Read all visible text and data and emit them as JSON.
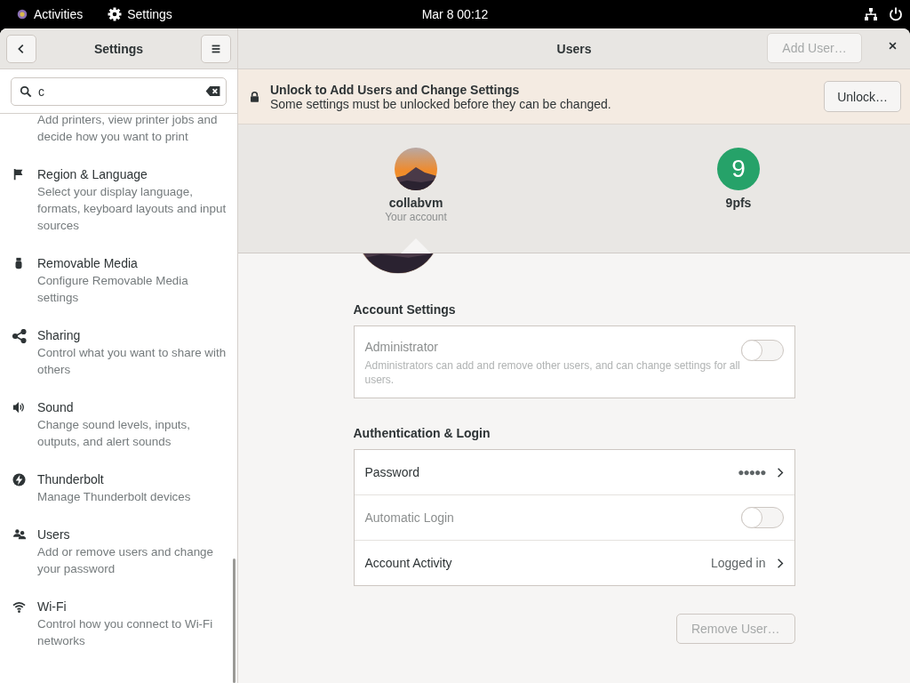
{
  "top_bar": {
    "activities": "Activities",
    "app": "Settings",
    "clock": "Mar 8  00:12"
  },
  "sidebar": {
    "title": "Settings",
    "search": {
      "value": "c"
    },
    "items": [
      {
        "kind": "printer",
        "description": "Add printers, view printer jobs and decide how you want to print",
        "selected": false
      },
      {
        "kind": "flag",
        "title": "Region & Language",
        "description": "Select your display language, formats, keyboard layouts and input sources",
        "selected": false
      },
      {
        "kind": "usb",
        "title": "Removable Media",
        "description": "Configure Removable Media settings",
        "selected": false
      },
      {
        "kind": "share",
        "title": "Sharing",
        "description": "Control what you want to share with others",
        "selected": false
      },
      {
        "kind": "sound",
        "title": "Sound",
        "description": "Change sound levels, inputs, outputs, and alert sounds",
        "selected": false
      },
      {
        "kind": "thunderbolt",
        "title": "Thunderbolt",
        "description": "Manage Thunderbolt devices",
        "selected": false
      },
      {
        "kind": "users",
        "title": "Users",
        "description": "Add or remove users and change your password",
        "selected": false
      },
      {
        "kind": "wifi",
        "title": "Wi-Fi",
        "description": "Control how you connect to Wi-Fi networks",
        "selected": false
      }
    ]
  },
  "header": {
    "title": "Users",
    "add_user": {
      "label": "Add User…",
      "disabled": true
    }
  },
  "lock_bar": {
    "title": "Unlock to Add Users and Change Settings",
    "subtitle": "Some settings must be unlocked before they can be changed.",
    "button": "Unlock…"
  },
  "accounts": [
    {
      "kind": "picture",
      "name": "collabvm",
      "note": "Your account",
      "selected": true
    },
    {
      "kind": "initial",
      "initial": "9",
      "name": "9pfs",
      "color": "#26a269",
      "selected": false
    }
  ],
  "account_settings": {
    "heading": "Account Settings",
    "administrator": {
      "label": "Administrator",
      "description": "Administrators can add and remove other users, and can change settings for all users.",
      "on": false,
      "disabled": true
    }
  },
  "authentication": {
    "heading": "Authentication & Login",
    "rows": [
      {
        "kind": "link",
        "label": "Password",
        "value": "●●●●●",
        "disabled": false
      },
      {
        "kind": "toggle",
        "label": "Automatic Login",
        "on": false,
        "disabled": true
      },
      {
        "kind": "link",
        "label": "Account Activity",
        "value": "Logged in",
        "disabled": false
      }
    ]
  },
  "remove_user": {
    "label": "Remove User…",
    "disabled": true
  }
}
